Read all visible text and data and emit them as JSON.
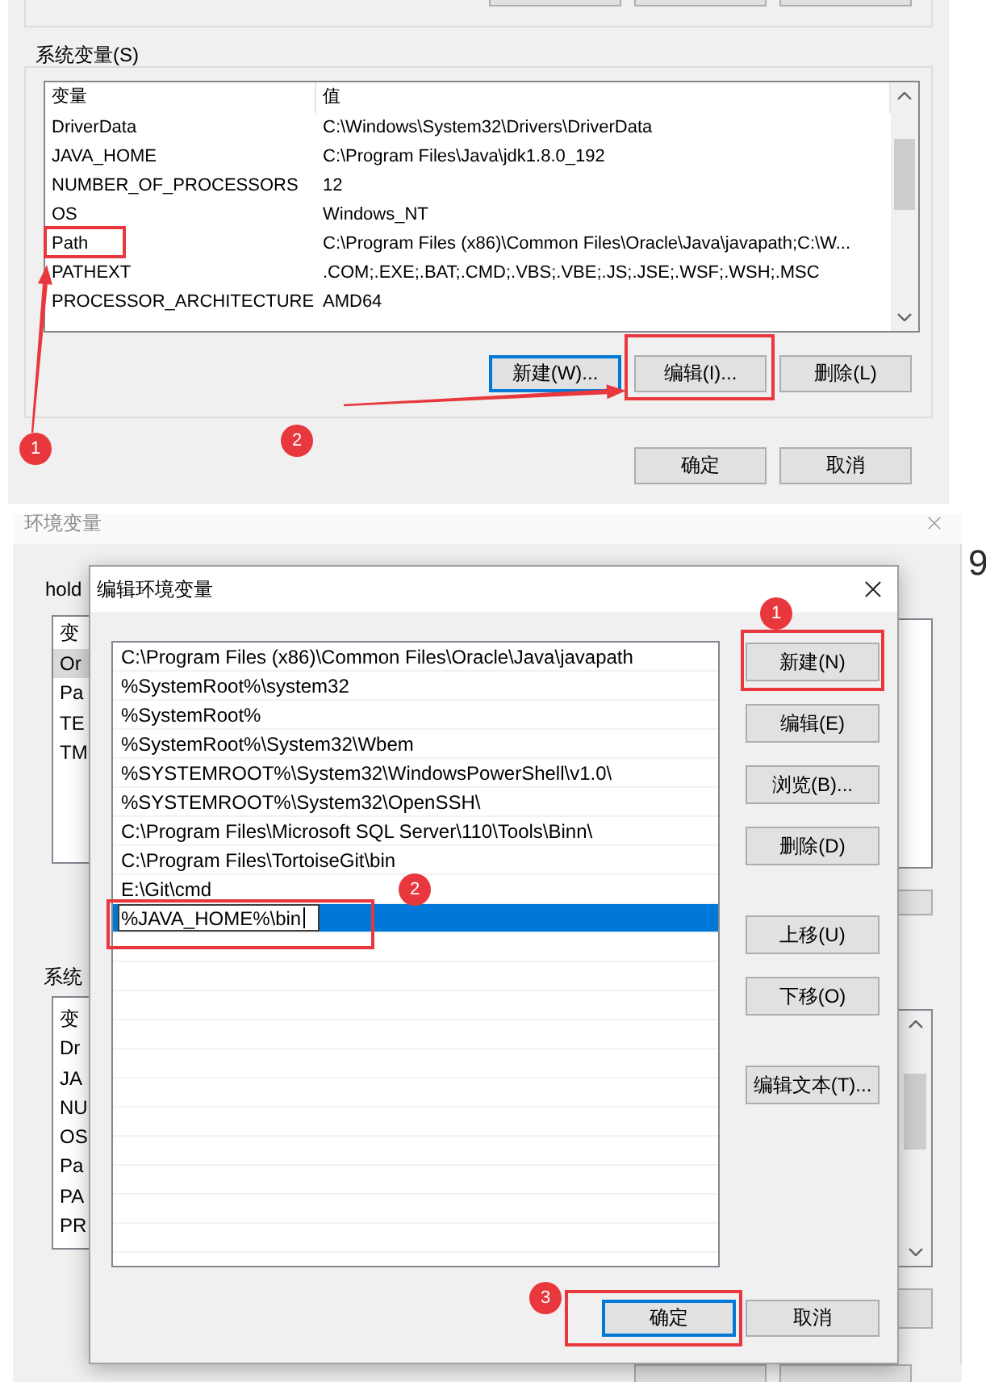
{
  "system_variables_window": {
    "group_label": "系统变量(S)",
    "columns": [
      "变量",
      "值"
    ],
    "rows": [
      {
        "name": "DriverData",
        "value": "C:\\Windows\\System32\\Drivers\\DriverData",
        "highlighted": false
      },
      {
        "name": "JAVA_HOME",
        "value": "C:\\Program Files\\Java\\jdk1.8.0_192",
        "highlighted": false
      },
      {
        "name": "NUMBER_OF_PROCESSORS",
        "value": "12",
        "highlighted": false
      },
      {
        "name": "OS",
        "value": "Windows_NT",
        "highlighted": false
      },
      {
        "name": "Path",
        "value": "C:\\Program Files (x86)\\Common Files\\Oracle\\Java\\javapath;C:\\W...",
        "highlighted": true,
        "badge": "1"
      },
      {
        "name": "PATHEXT",
        "value": ".COM;.EXE;.BAT;.CMD;.VBS;.VBE;.JS;.JSE;.WSF;.WSH;.MSC",
        "highlighted": false
      },
      {
        "name": "PROCESSOR_ARCHITECTURE",
        "value": "AMD64",
        "highlighted": false
      }
    ],
    "buttons": [
      {
        "label": "新建(W)...",
        "focused": true,
        "highlighted": false
      },
      {
        "label": "编辑(I)...",
        "focused": false,
        "highlighted": true,
        "badge": "2"
      },
      {
        "label": "删除(L)",
        "focused": false,
        "highlighted": false
      }
    ],
    "dialog_buttons": [
      {
        "label": "确定",
        "focused": false
      },
      {
        "label": "取消",
        "focused": false
      }
    ]
  },
  "environment_window": {
    "title": "环境变量",
    "user_group_label": "hold",
    "user_list": {
      "header": "变",
      "rows": [
        {
          "text": "Or",
          "selected": true
        },
        {
          "text": "Pa",
          "selected": false
        },
        {
          "text": "TE",
          "selected": false
        },
        {
          "text": "TM",
          "selected": false
        }
      ]
    },
    "system_group_label": "系统",
    "system_list": {
      "header": "变",
      "rows": [
        {
          "text": "Dr",
          "selected": false
        },
        {
          "text": "JA",
          "selected": false
        },
        {
          "text": "NU",
          "selected": false
        },
        {
          "text": "OS",
          "selected": false
        },
        {
          "text": "Pa",
          "selected": false
        },
        {
          "text": "PA",
          "selected": false
        },
        {
          "text": "PR",
          "selected": false
        }
      ]
    }
  },
  "side_text": "9",
  "edit_dialog": {
    "title": "编辑环境变量",
    "entries": [
      {
        "text": "C:\\Program Files (x86)\\Common Files\\Oracle\\Java\\javapath",
        "selected": false,
        "editing": false,
        "highlighted": false
      },
      {
        "text": "%SystemRoot%\\system32",
        "selected": false,
        "editing": false,
        "highlighted": false
      },
      {
        "text": "%SystemRoot%",
        "selected": false,
        "editing": false,
        "highlighted": false
      },
      {
        "text": "%SystemRoot%\\System32\\Wbem",
        "selected": false,
        "editing": false,
        "highlighted": false
      },
      {
        "text": "%SYSTEMROOT%\\System32\\WindowsPowerShell\\v1.0\\",
        "selected": false,
        "editing": false,
        "highlighted": false
      },
      {
        "text": "%SYSTEMROOT%\\System32\\OpenSSH\\",
        "selected": false,
        "editing": false,
        "highlighted": false
      },
      {
        "text": "C:\\Program Files\\Microsoft SQL Server\\110\\Tools\\Binn\\",
        "selected": false,
        "editing": false,
        "highlighted": false
      },
      {
        "text": "C:\\Program Files\\TortoiseGit\\bin",
        "selected": false,
        "editing": false,
        "highlighted": false
      },
      {
        "text": "E:\\Git\\cmd",
        "selected": false,
        "editing": false,
        "highlighted": false
      },
      {
        "text": "%JAVA_HOME%\\bin",
        "selected": true,
        "editing": true,
        "highlighted": true,
        "badge": "2"
      }
    ],
    "button_groups": [
      [
        {
          "label": "新建(N)",
          "highlighted": true,
          "badge": "1"
        },
        {
          "label": "编辑(E)",
          "highlighted": false
        },
        {
          "label": "浏览(B)...",
          "highlighted": false
        },
        {
          "label": "删除(D)",
          "highlighted": false
        }
      ],
      [
        {
          "label": "上移(U)",
          "highlighted": false
        },
        {
          "label": "下移(O)",
          "highlighted": false
        }
      ],
      [
        {
          "label": "编辑文本(T)...",
          "highlighted": false
        }
      ]
    ],
    "footer_buttons": [
      {
        "label": "确定",
        "focused": true,
        "highlighted": true,
        "badge": "3"
      },
      {
        "label": "取消",
        "focused": false,
        "highlighted": false
      }
    ]
  }
}
